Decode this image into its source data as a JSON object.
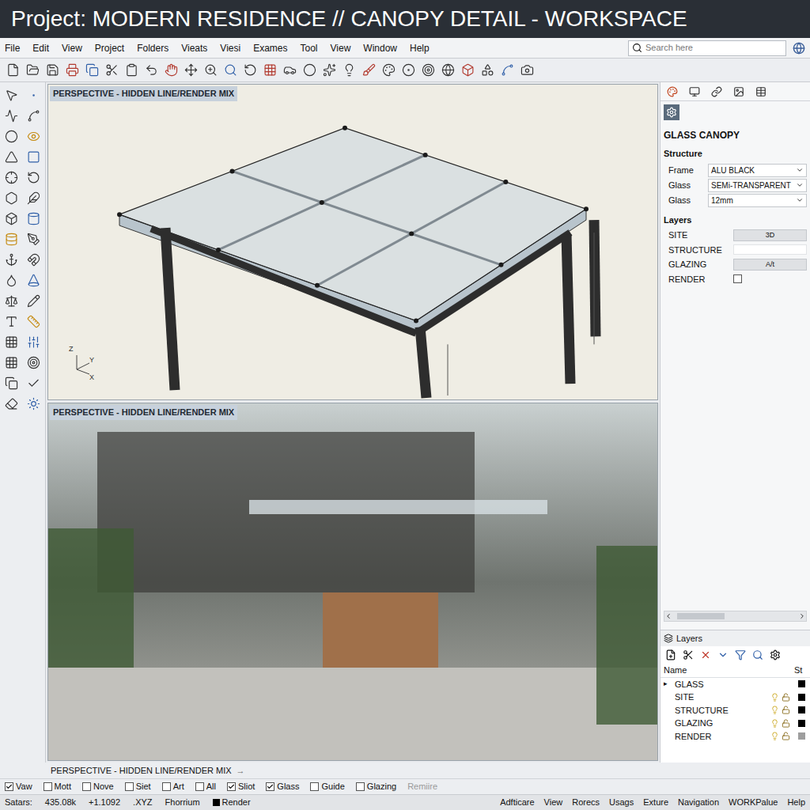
{
  "window": {
    "title": "Project: MODERN RESIDENCE // CANOPY DETAIL - WORKSPACE"
  },
  "menu": [
    "File",
    "Edit",
    "View",
    "Project",
    "Folders",
    "Vieats",
    "Viesi",
    "Exames",
    "Tool",
    "View",
    "Window",
    "Help"
  ],
  "search": {
    "placeholder": "Search here"
  },
  "viewports": [
    {
      "label": "PERSPECTIVE - HIDDEN LINE/RENDER MIX",
      "kind": "wireframe",
      "axes": [
        "Z",
        "Y",
        "X"
      ]
    },
    {
      "label": "PERSPECTIVE - HIDDEN LINE/RENDER MIX",
      "kind": "render",
      "axes": []
    }
  ],
  "viewport_caption": {
    "label": "PERSPECTIVE - HIDDEN LINE/RENDER MIX",
    "arrow": "→"
  },
  "properties": {
    "title": "GLASS CANOPY",
    "section": "Structure",
    "fields": [
      {
        "label": "Frame",
        "value": "ALU BLACK"
      },
      {
        "label": "Glass",
        "value": "SEMi-TRANSPARENT"
      },
      {
        "label": "Glass",
        "value": "12mm"
      }
    ],
    "layers_title": "Layers",
    "layers": [
      {
        "name": "SITE",
        "kind": "button",
        "value": "3D"
      },
      {
        "name": "STRUCTURE",
        "kind": "field"
      },
      {
        "name": "GLAZING",
        "kind": "button",
        "value": "A/t"
      },
      {
        "name": "RENDER",
        "kind": "checkbox",
        "checked": false
      }
    ]
  },
  "layers_panel": {
    "tab": "Layers",
    "columns": [
      "Name",
      "St"
    ],
    "rows": [
      {
        "name": "GLASS",
        "kind": "group",
        "marker": "▸",
        "color": "#000000"
      },
      {
        "name": "SITE",
        "kind": "layer",
        "visible": true,
        "locked": false,
        "color": "#000000"
      },
      {
        "name": "STRUCTURE",
        "kind": "layer",
        "visible": true,
        "locked": false,
        "color": "#000000"
      },
      {
        "name": "GLAZING",
        "kind": "layer",
        "visible": true,
        "locked": false,
        "color": "#000000"
      },
      {
        "name": "RENDER",
        "kind": "layer",
        "visible": true,
        "locked": false,
        "color": "#9e9e9e"
      }
    ]
  },
  "options": [
    {
      "label": "Vaw",
      "kind": "checkbox",
      "checked": true
    },
    {
      "label": "Mott",
      "kind": "checkbox",
      "checked": false
    },
    {
      "label": "Nove",
      "kind": "checkbox",
      "checked": false
    },
    {
      "label": "Siet",
      "kind": "checkbox",
      "checked": false
    },
    {
      "label": "Art",
      "kind": "checkbox",
      "checked": false
    },
    {
      "label": "All",
      "kind": "checkbox",
      "checked": false
    },
    {
      "label": "Sliot",
      "kind": "checkbox",
      "checked": true
    },
    {
      "label": "Glass",
      "kind": "checkbox",
      "checked": true
    },
    {
      "label": "Guide",
      "kind": "checkbox",
      "checked": false
    },
    {
      "label": "Glazing",
      "kind": "checkbox",
      "checked": false
    },
    {
      "label": "Remiire",
      "kind": "label",
      "disabled": true
    }
  ],
  "status_bar": {
    "left": [
      "Satars:",
      "435.08k",
      "+1.1092",
      ".XYZ",
      "Fhorrium"
    ],
    "render": {
      "label": "Render",
      "color": "#000000"
    },
    "right": [
      "Adfticare",
      "View",
      "Rorecs",
      "Usags",
      "Exture",
      "Navigation",
      "WORKPalue",
      "Help"
    ]
  }
}
